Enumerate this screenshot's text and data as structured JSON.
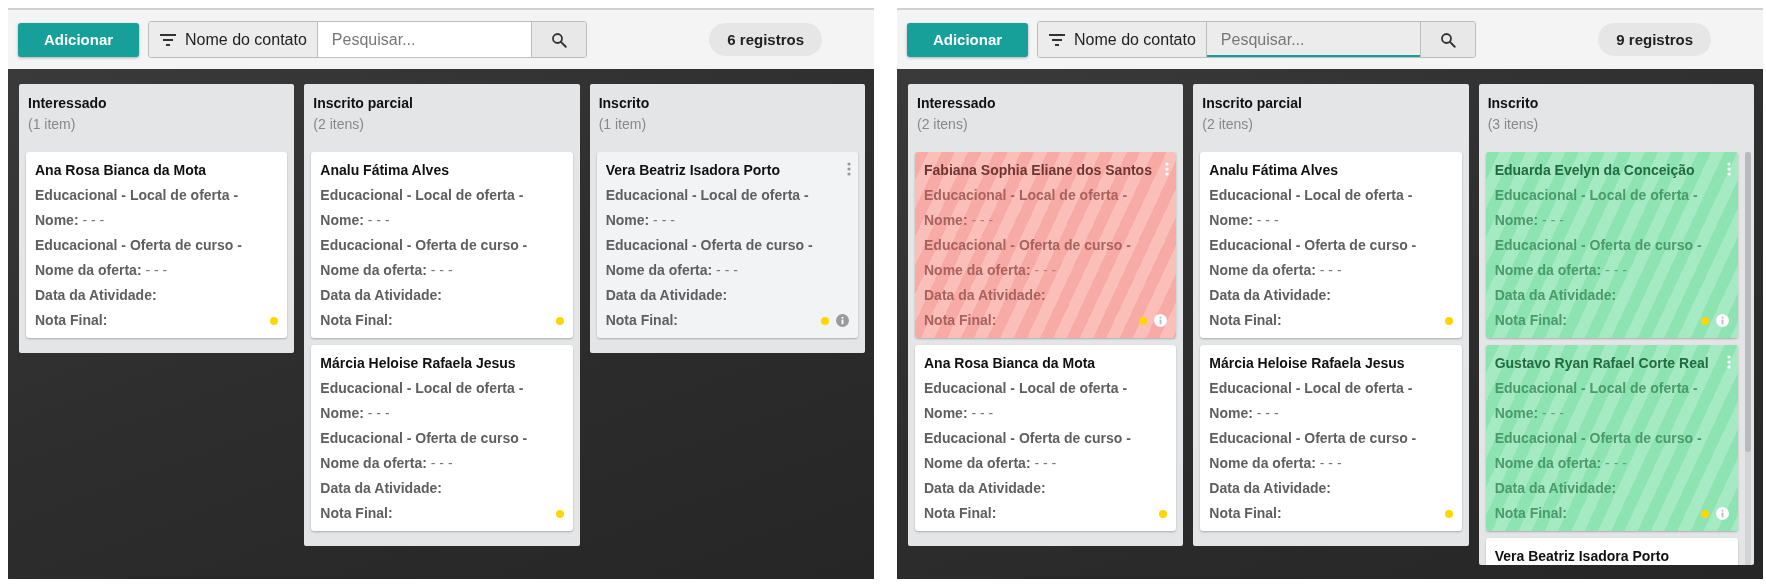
{
  "panels": [
    {
      "add_button": "Adicionar",
      "filter_label": "Nome do contato",
      "search": {
        "placeholder": "Pesquisar...",
        "focused": false
      },
      "record_count": "6 registros",
      "columns": [
        {
          "title": "Interessado",
          "count": "(1 item)",
          "scrollable": false,
          "cards": [
            {
              "kind": "plain",
              "name": "Ana Rosa Bianca da Mota",
              "menu": false,
              "info": false,
              "color": "#ffd600",
              "fields": [
                "**Educacional - Local de oferta -**",
                "**Nome:** - - -",
                "**Educacional - Oferta de curso -**",
                "**Nome da oferta:** - - -",
                "**Data da Atividade:**",
                "**Nota Final:**"
              ]
            }
          ]
        },
        {
          "title": "Inscrito parcial",
          "count": "(2 itens)",
          "scrollable": false,
          "cards": [
            {
              "kind": "plain",
              "name": "Analu Fátima Alves",
              "menu": false,
              "info": false,
              "color": "#ffd600",
              "fields": [
                "**Educacional - Local de oferta -**",
                "**Nome:** - - -",
                "**Educacional - Oferta de curso -**",
                "**Nome da oferta:** - - -",
                "**Data da Atividade:**",
                "**Nota Final:**"
              ]
            },
            {
              "kind": "plain",
              "name": "Márcia Heloise Rafaela Jesus",
              "menu": false,
              "info": false,
              "color": "#ffd600",
              "fields": [
                "**Educacional - Local de oferta -**",
                "**Nome:** - - -",
                "**Educacional - Oferta de curso -**",
                "**Nome da oferta:** - - -",
                "**Data da Atividade:**",
                "**Nota Final:**"
              ]
            }
          ]
        },
        {
          "title": "Inscrito",
          "count": "(1 item)",
          "scrollable": false,
          "cards": [
            {
              "kind": "hover",
              "name": "Vera Beatriz Isadora Porto",
              "menu": true,
              "info": true,
              "color": "#ffd600",
              "fields": [
                "**Educacional - Local de oferta -**",
                "**Nome:** - - -",
                "**Educacional - Oferta de curso -**",
                "**Nome da oferta:** - - -",
                "**Data da Atividade:**",
                "**Nota Final:**"
              ]
            }
          ]
        }
      ]
    },
    {
      "add_button": "Adicionar",
      "filter_label": "Nome do contato",
      "search": {
        "placeholder": "Pesquisar...",
        "focused": true
      },
      "record_count": "9 registros",
      "columns": [
        {
          "title": "Interessado",
          "count": "(2 itens)",
          "scrollable": false,
          "cards": [
            {
              "kind": "lost",
              "name": "Fabiana Sophia Eliane dos Santos",
              "menu": true,
              "info": true,
              "color": "#ffd600",
              "fields": [
                "**Educacional - Local de oferta -**",
                "**Nome:** - - -",
                "**Educacional - Oferta de curso -**",
                "**Nome da oferta:** - - -",
                "**Data da Atividade:**",
                "**Nota Final:**"
              ]
            },
            {
              "kind": "plain",
              "name": "Ana Rosa Bianca da Mota",
              "menu": false,
              "info": false,
              "color": "#ffd600",
              "fields": [
                "**Educacional - Local de oferta -**",
                "**Nome:** - - -",
                "**Educacional - Oferta de curso -**",
                "**Nome da oferta:** - - -",
                "**Data da Atividade:**",
                "**Nota Final:**"
              ]
            }
          ]
        },
        {
          "title": "Inscrito parcial",
          "count": "(2 itens)",
          "scrollable": false,
          "cards": [
            {
              "kind": "plain",
              "name": "Analu Fátima Alves",
              "menu": false,
              "info": false,
              "color": "#ffd600",
              "fields": [
                "**Educacional - Local de oferta -**",
                "**Nome:** - - -",
                "**Educacional - Oferta de curso -**",
                "**Nome da oferta:** - - -",
                "**Data da Atividade:**",
                "**Nota Final:**"
              ]
            },
            {
              "kind": "plain",
              "name": "Márcia Heloise Rafaela Jesus",
              "menu": false,
              "info": false,
              "color": "#ffd600",
              "fields": [
                "**Educacional - Local de oferta -**",
                "**Nome:** - - -",
                "**Educacional - Oferta de curso -**",
                "**Nome da oferta:** - - -",
                "**Data da Atividade:**",
                "**Nota Final:**"
              ]
            }
          ]
        },
        {
          "title": "Inscrito",
          "count": "(3 itens)",
          "scrollable": true,
          "cards": [
            {
              "kind": "won",
              "name": "Eduarda Evelyn da Conceição",
              "menu": true,
              "info": true,
              "color": "#ffd600",
              "fields": [
                "**Educacional - Local de oferta -**",
                "**Nome:** - - -",
                "**Educacional - Oferta de curso -**",
                "**Nome da oferta:** - - -",
                "**Data da Atividade:**",
                "**Nota Final:**"
              ]
            },
            {
              "kind": "won",
              "name": "Gustavo Ryan Rafael Corte Real",
              "menu": true,
              "info": true,
              "color": "#ffd600",
              "fields": [
                "**Educacional - Local de oferta -**",
                "**Nome:** - - -",
                "**Educacional - Oferta de curso -**",
                "**Nome da oferta:** - - -",
                "**Data da Atividade:**",
                "**Nota Final:**"
              ]
            },
            {
              "kind": "plain",
              "name": "Vera Beatriz Isadora Porto",
              "menu": false,
              "info": false
            }
          ]
        }
      ]
    }
  ]
}
